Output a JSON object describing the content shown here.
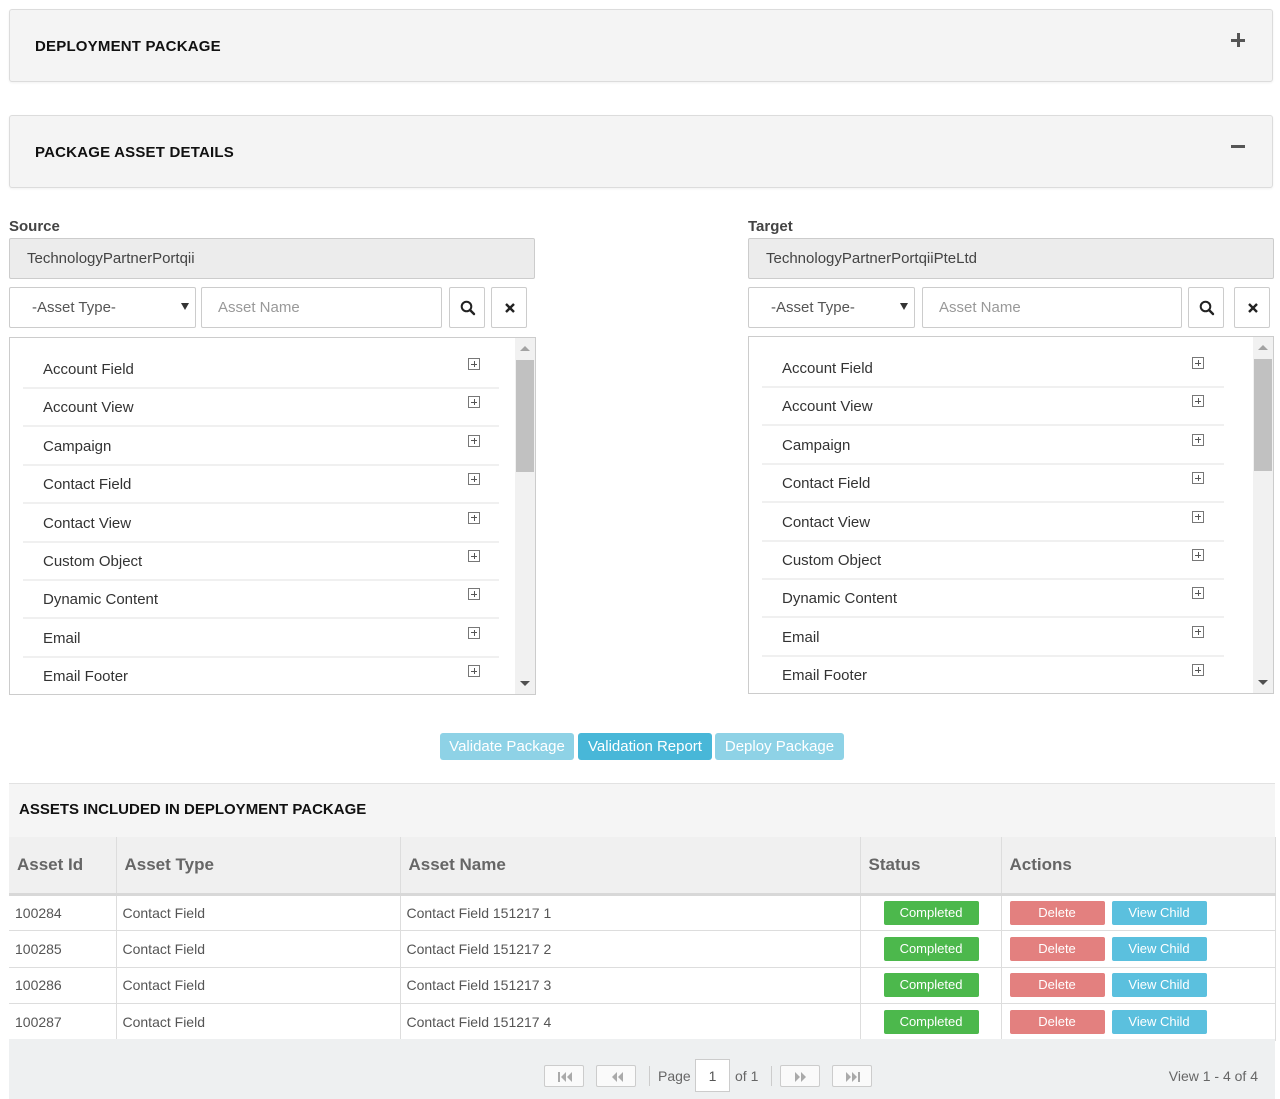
{
  "deployment_panel": {
    "title": "DEPLOYMENT PACKAGE",
    "toggle_icon": "plus-icon"
  },
  "asset_details_panel": {
    "title": "PACKAGE ASSET DETAILS",
    "toggle_icon": "minus-icon"
  },
  "source": {
    "label": "Source",
    "instance": "TechnologyPartnerPortqii",
    "asset_type_select": "-Asset Type-",
    "asset_name_placeholder": "Asset Name",
    "items": [
      "Account Field",
      "Account View",
      "Campaign",
      "Contact Field",
      "Contact View",
      "Custom Object",
      "Dynamic Content",
      "Email",
      "Email Footer"
    ]
  },
  "target": {
    "label": "Target",
    "instance": "TechnologyPartnerPortqiiPteLtd",
    "asset_type_select": "-Asset Type-",
    "asset_name_placeholder": "Asset Name",
    "items": [
      "Account Field",
      "Account View",
      "Campaign",
      "Contact Field",
      "Contact View",
      "Custom Object",
      "Dynamic Content",
      "Email",
      "Email Footer"
    ]
  },
  "actions": {
    "validate": "Validate Package",
    "report": "Validation Report",
    "deploy": "Deploy Package"
  },
  "assets": {
    "title": "ASSETS INCLUDED IN DEPLOYMENT PACKAGE",
    "columns": [
      "Asset Id",
      "Asset Type",
      "Asset Name",
      "Status",
      "Actions"
    ],
    "rows": [
      {
        "id": "100284",
        "type": "Contact Field",
        "name": "Contact Field 151217 1",
        "status": "Completed",
        "delete": "Delete",
        "view_child": "View Child"
      },
      {
        "id": "100285",
        "type": "Contact Field",
        "name": "Contact Field 151217 2",
        "status": "Completed",
        "delete": "Delete",
        "view_child": "View Child"
      },
      {
        "id": "100286",
        "type": "Contact Field",
        "name": "Contact Field 151217 3",
        "status": "Completed",
        "delete": "Delete",
        "view_child": "View Child"
      },
      {
        "id": "100287",
        "type": "Contact Field",
        "name": "Contact Field 151217 4",
        "status": "Completed",
        "delete": "Delete",
        "view_child": "View Child"
      }
    ]
  },
  "pagination": {
    "page_label": "Page",
    "current_page": "1",
    "of_label": "of 1",
    "view_text": "View 1 - 4 of 4"
  },
  "colors": {
    "completed": "#4cb84c",
    "delete": "#e3807f",
    "view_child": "#5bc0de",
    "disabled_button": "#8ed2e6",
    "active_button": "#48b7d8"
  }
}
